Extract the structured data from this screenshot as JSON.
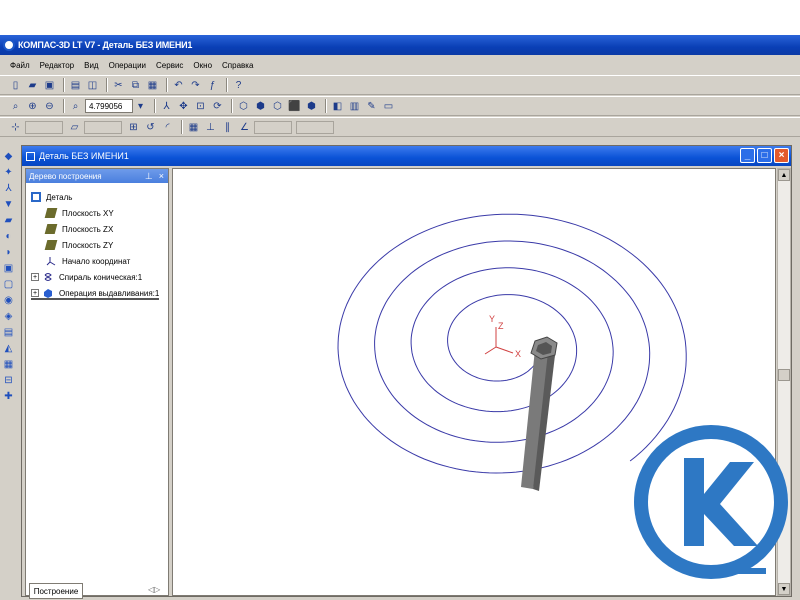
{
  "app": {
    "title": "КОМПАС-3D LT V7 - Деталь БЕЗ ИМЕНИ1"
  },
  "menu": {
    "items": [
      "Файл",
      "Редактор",
      "Вид",
      "Операции",
      "Сервис",
      "Окно",
      "Справка"
    ]
  },
  "toolbar": {
    "zoom_value": "4.799056"
  },
  "document": {
    "title": "Деталь БЕЗ ИМЕНИ1"
  },
  "tree": {
    "header": "Дерево построения",
    "root": "Деталь",
    "items": [
      {
        "label": "Плоскость XY",
        "icon": "plane-icon"
      },
      {
        "label": "Плоскость ZX",
        "icon": "plane-icon"
      },
      {
        "label": "Плоскость ZY",
        "icon": "plane-icon"
      },
      {
        "label": "Начало координат",
        "icon": "axes-icon"
      },
      {
        "label": "Спираль коническая:1",
        "icon": "spiral-icon"
      },
      {
        "label": "Операция выдавливания:1",
        "icon": "extrude-icon"
      }
    ],
    "bottom_tab": "Построение"
  },
  "viewport": {
    "axis_labels": {
      "y": "Y",
      "z": "Z",
      "x": "X"
    }
  },
  "colors": {
    "spiral": "#3a3aa8",
    "axes": "#d04040",
    "logo": "#2e78c4",
    "titlebar": "#0a3fb6"
  }
}
